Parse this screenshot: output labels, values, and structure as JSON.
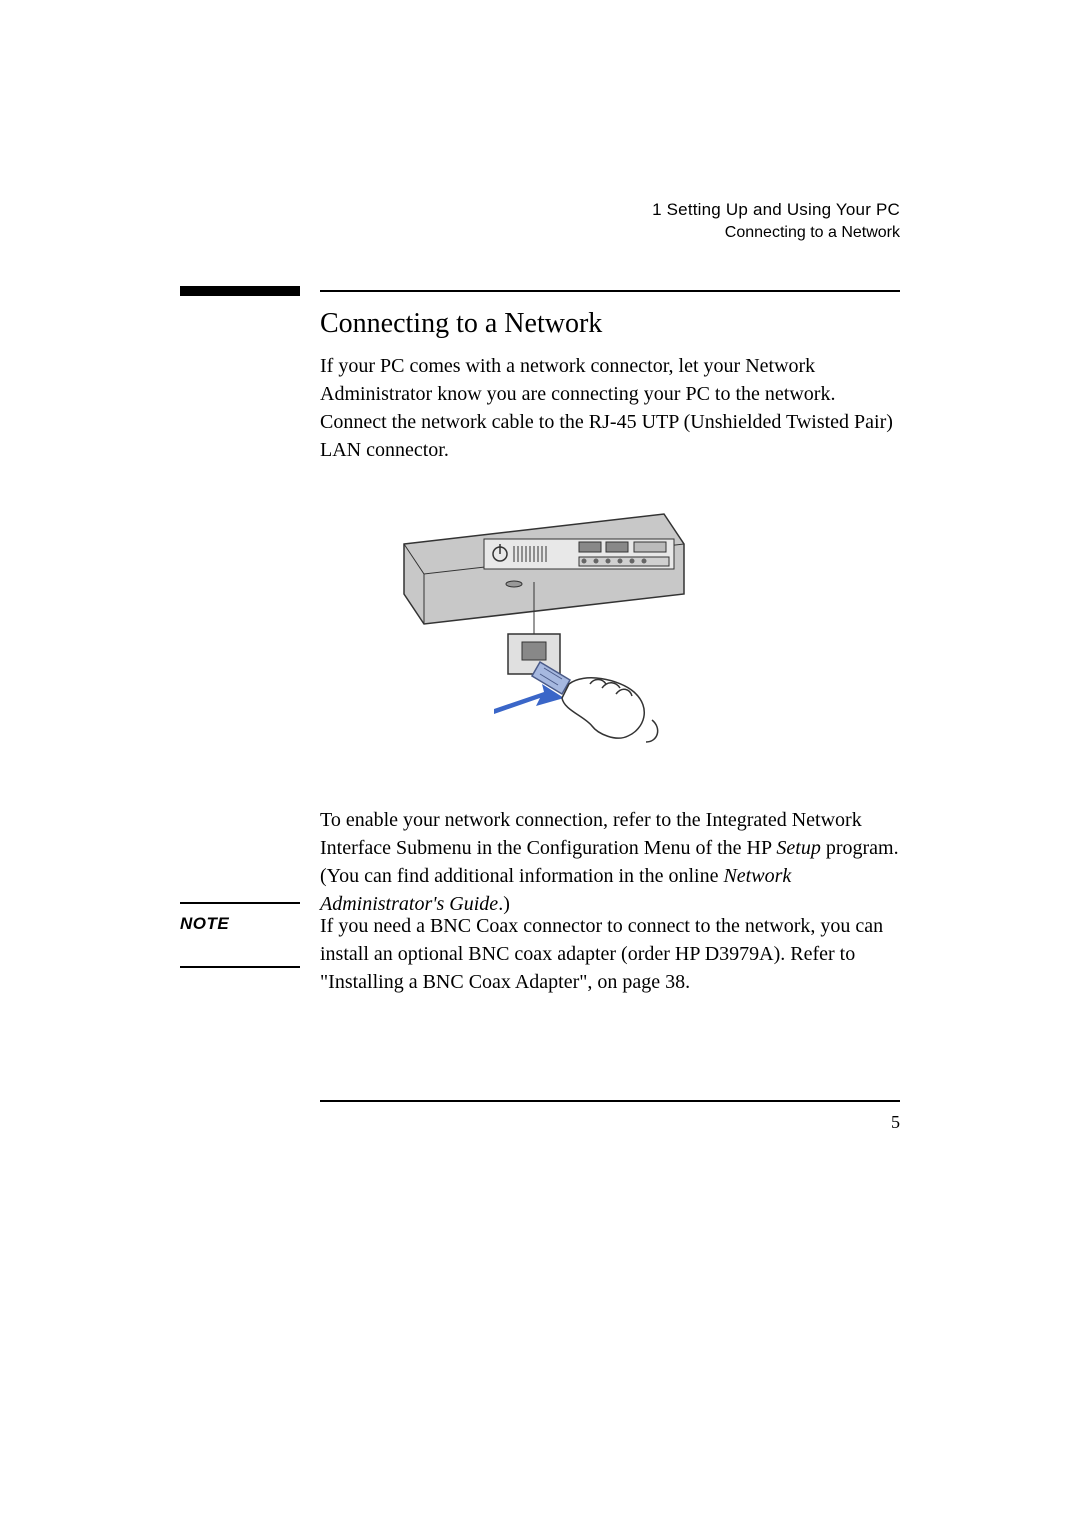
{
  "header": {
    "chapter": "1  Setting Up and Using Your PC",
    "section": "Connecting to a Network"
  },
  "heading": "Connecting to a Network",
  "para1": "If your PC comes with a network connector, let your Network Administrator know you are connecting your PC to the network. Connect the network cable to the RJ-45 UTP (Unshielded Twisted Pair) LAN connector.",
  "para2_pre": "To enable your network connection, refer to the Integrated Network Interface Submenu in the Configuration Menu of the HP ",
  "para2_it1": "Setup",
  "para2_mid": " program. (You can find additional information in the online ",
  "para2_it2": "Network Administrator's Guide",
  "para2_post": ".)",
  "note_label": "NOTE",
  "para3": "If you need a BNC Coax connector to connect to the network, you can install an optional BNC coax adapter (order HP D3979A). Refer to \"Installing a BNC Coax Adapter\", on page 38.",
  "page_number": "5"
}
